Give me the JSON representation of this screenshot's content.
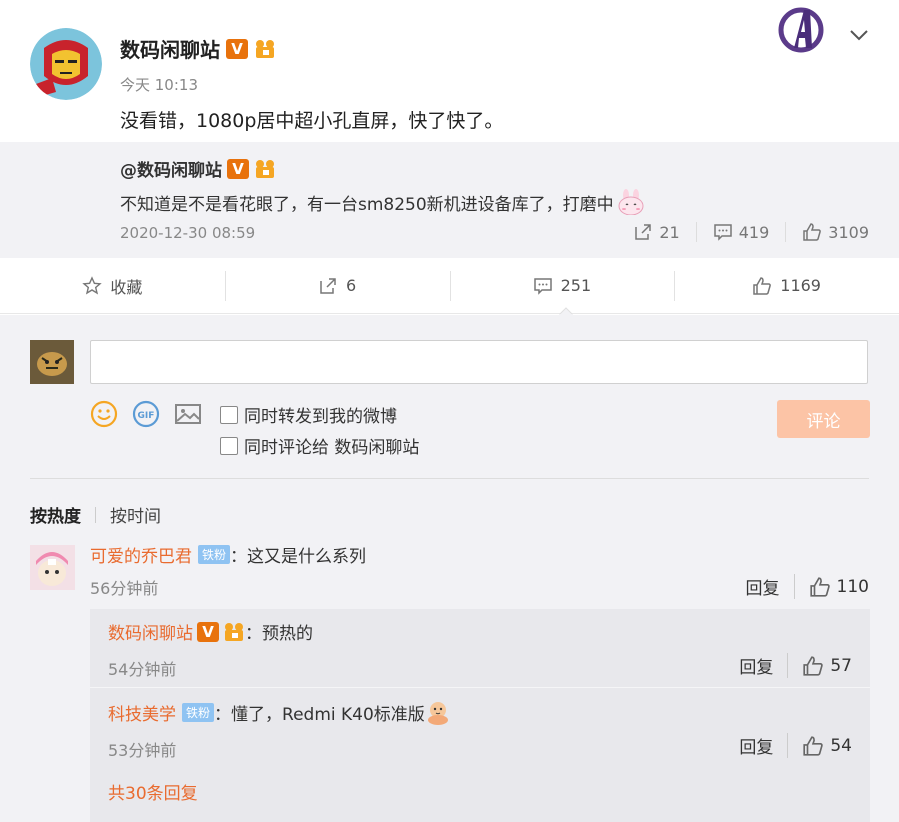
{
  "post": {
    "author": "数码闲聊站",
    "time": "今天 10:13",
    "text": "没看错，1080p居中超小孔直屏，快了快了。"
  },
  "repost": {
    "author": "@数码闲聊站",
    "text": "不知道是不是看花眼了，有一台sm8250新机进设备库了，打磨中",
    "date": "2020-12-30 08:59",
    "forwards": "21",
    "comments": "419",
    "likes": "3109"
  },
  "actions": {
    "favorite": "收藏",
    "forward": "6",
    "comment": "251",
    "like": "1169"
  },
  "compose": {
    "placeholder": "",
    "option_forward": "同时转发到我的微博",
    "option_comment": "同时评论给 数码闲聊站",
    "submit": "评论"
  },
  "sort": {
    "hot": "按热度",
    "time": "按时间"
  },
  "comment": {
    "user": "可爱的乔巴君",
    "badge": "铁粉",
    "text": "：这又是什么系列",
    "time": "56分钟前",
    "reply": "回复",
    "likes": "110"
  },
  "replies": [
    {
      "user": "数码闲聊站",
      "text": "：预热的",
      "time": "54分钟前",
      "reply": "回复",
      "likes": "57"
    },
    {
      "user": "科技美学",
      "badge": "铁粉",
      "text": "：懂了，Redmi K40标准版",
      "time": "53分钟前",
      "reply": "回复",
      "likes": "54"
    }
  ],
  "more_replies": "共30条回复",
  "colors": {
    "username": "#e96b2f",
    "vip_badge": "#e8720c",
    "fan_badge": "#8fc3f2",
    "submit_disabled": "#fcc4a6"
  }
}
